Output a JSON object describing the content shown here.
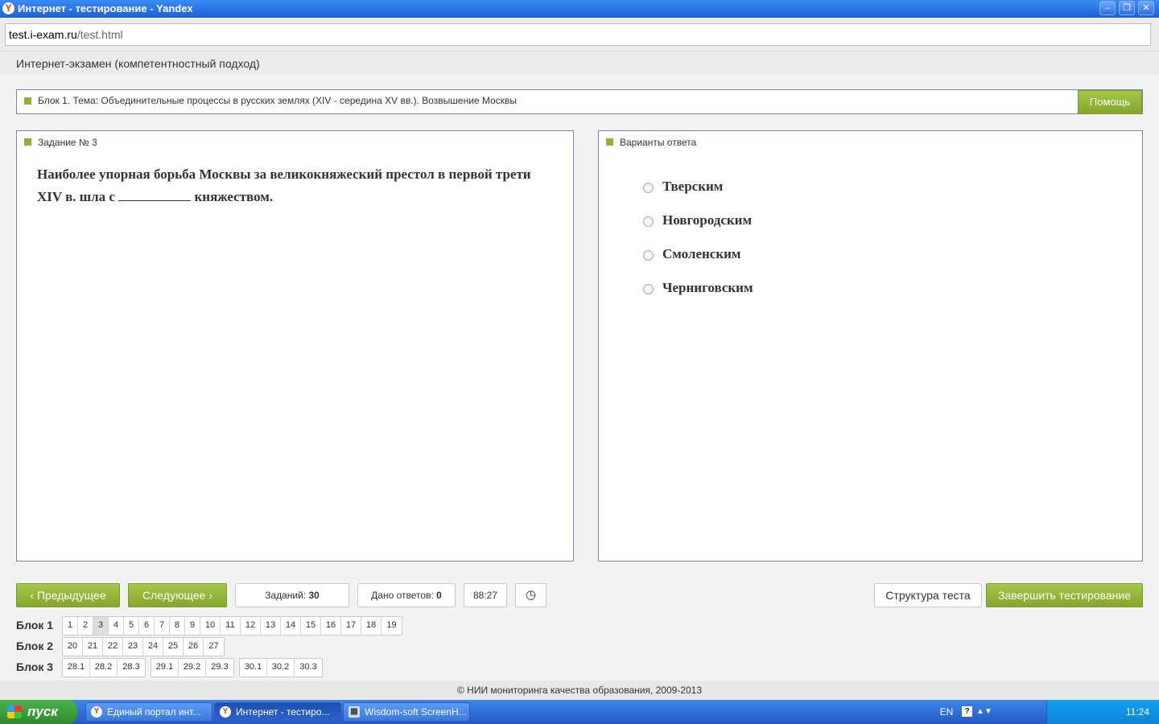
{
  "window": {
    "title": "Интернет - тестирование - Yandex",
    "icon": "yandex-icon"
  },
  "address": {
    "host": "test.i-exam.ru",
    "path": "/test.html"
  },
  "page": {
    "title": "Интернет-экзамен (компетентностный подход)"
  },
  "block": {
    "title": "Блок 1. Тема: Объединительные процессы в русских землях (XIV - середина XV вв.). Возвышение Москвы",
    "help_label": "Помощь"
  },
  "task": {
    "title": "Задание № 3",
    "question_before": "Наиболее упорная борьба Москвы за великокняжеский престол в первой трети XIV в. шла с",
    "question_after": "княжеством."
  },
  "answers": {
    "title": "Варианты ответа",
    "options": [
      "Тверским",
      "Новгородским",
      "Смоленским",
      "Черниговским"
    ]
  },
  "controls": {
    "prev_label": "Предыдущее",
    "next_label": "Следующее",
    "tasks_label": "Заданий:",
    "tasks_value": "30",
    "answered_label": "Дано ответов:",
    "answered_value": "0",
    "timer": "88:27",
    "structure_label": "Структура теста",
    "finish_label": "Завершить тестирование"
  },
  "navigator": {
    "blocks": [
      {
        "label": "Блок 1",
        "groups": [
          [
            "1",
            "2",
            "3",
            "4",
            "5",
            "6",
            "7",
            "8",
            "9",
            "10",
            "11",
            "12",
            "13",
            "14",
            "15",
            "16",
            "17",
            "18",
            "19"
          ]
        ],
        "active": "3"
      },
      {
        "label": "Блок 2",
        "groups": [
          [
            "20",
            "21",
            "22",
            "23",
            "24",
            "25",
            "26",
            "27"
          ]
        ]
      },
      {
        "label": "Блок 3",
        "groups": [
          [
            "28.1",
            "28.2",
            "28.3"
          ],
          [
            "29.1",
            "29.2",
            "29.3"
          ],
          [
            "30.1",
            "30.2",
            "30.3"
          ]
        ]
      }
    ]
  },
  "footer": {
    "text": "© НИИ мониторинга качества образования, 2009-2013"
  },
  "taskbar": {
    "start_label": "пуск",
    "items": [
      "Единый портал инт...",
      "Интернет - тестиро...",
      "Wisdom-soft ScreenH..."
    ],
    "lang": "EN",
    "clock": "11:24"
  },
  "colors": {
    "accent_green": "#8fb33a",
    "panel_border": "#7c83b5",
    "titlebar_blue": "#2a6be0"
  }
}
